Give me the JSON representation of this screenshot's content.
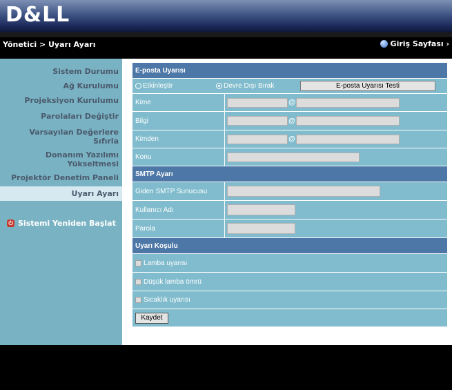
{
  "header": {
    "logo": "D&LL",
    "breadcrumb": "Yönetici > Uyarı Ayarı",
    "home_link": "Giriş Sayfası ›"
  },
  "sidebar": {
    "items": [
      {
        "label": "Sistem Durumu"
      },
      {
        "label": "Ağ Kurulumu"
      },
      {
        "label": "Projeksiyon Kurulumu"
      },
      {
        "label": "Parolaları Değiştir"
      },
      {
        "label": "Varsayılan Değerlere Sıfırla"
      },
      {
        "label": "Donanım Yazılımı Yükseltmesi"
      },
      {
        "label": "Projektör Denetim Paneli"
      },
      {
        "label": "Uyarı Ayarı"
      }
    ],
    "restart": "Sistemi Yeniden Başlat"
  },
  "email": {
    "section": "E-posta Uyarısı",
    "enable": "Etkinleştir",
    "disable": "Devre Dışı Bırak",
    "selected": "disable",
    "test_button": "E-posta Uyarısı Testi",
    "to": "Kime",
    "cc": "Bilgi",
    "from": "Kimden",
    "subject": "Konu",
    "at": "@"
  },
  "smtp": {
    "section": "SMTP Ayarı",
    "server": "Giden SMTP Sunucusu",
    "user": "Kullanıcı Adı",
    "password": "Parola"
  },
  "conditions": {
    "section": "Uyarı Koşulu",
    "lamp": "Lamba uyarısı",
    "low_lamp": "Düşük lamba ömrü",
    "temp": "Sıcaklık uyarısı"
  },
  "save": "Kaydet",
  "colors": {
    "sidebar": "#79b3c3",
    "section_header": "#4d77a6",
    "row": "#80bccd",
    "sidebar_text": "#4b5a6d"
  }
}
